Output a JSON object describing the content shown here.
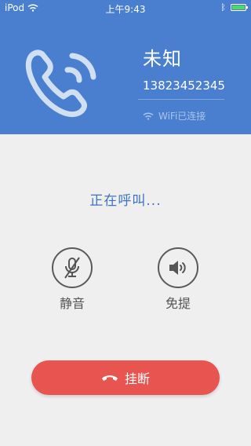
{
  "status_bar": {
    "device": "iPod",
    "time": "上午9:43"
  },
  "caller": {
    "name": "未知",
    "number": "13823452345",
    "network_status": "WiFi已连接"
  },
  "call_status": "正在呼叫...",
  "controls": {
    "mute_label": "静音",
    "speaker_label": "免提"
  },
  "hangup_label": "挂断",
  "colors": {
    "header_bg": "#4a7fcf",
    "accent_text": "#3d73c6",
    "hangup_bg": "#e85450",
    "battery": "#4cd964"
  },
  "icons": {
    "phone": "phone-ringing-icon",
    "wifi": "wifi-icon",
    "mute": "microphone-muted-icon",
    "speaker": "speaker-icon",
    "hangup": "hang-up-icon",
    "bluetooth": "bluetooth-icon",
    "battery": "battery-icon"
  }
}
